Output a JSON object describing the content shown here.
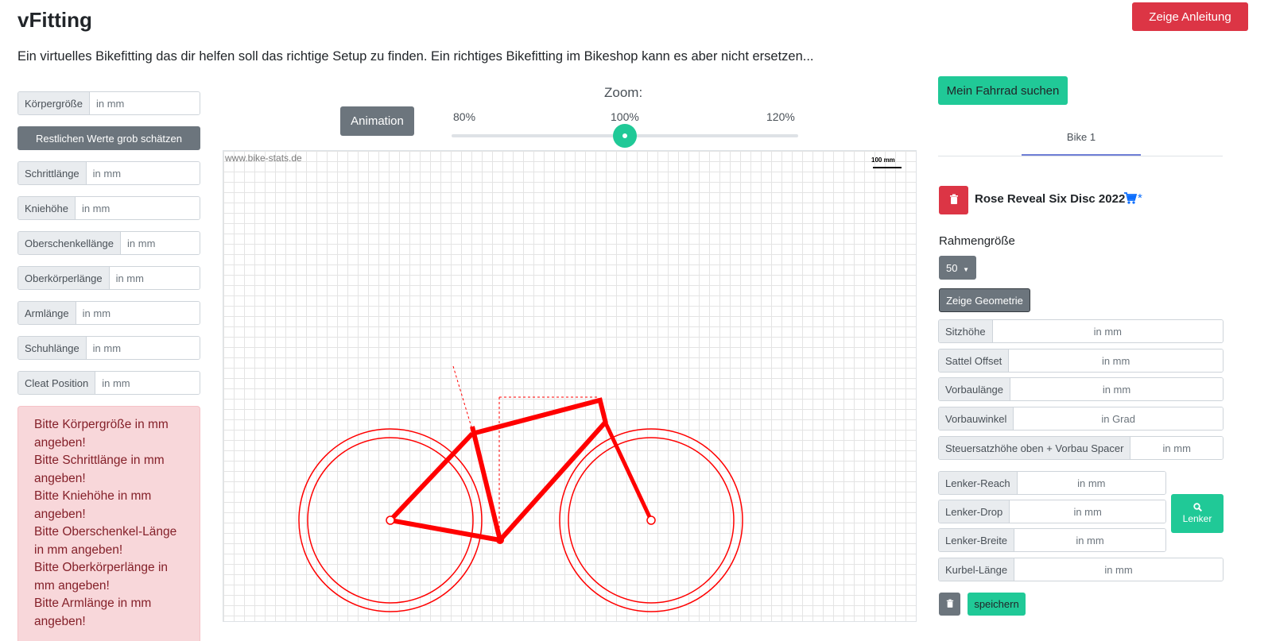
{
  "header": {
    "title": "vFitting",
    "guide_button": "Zeige Anleitung",
    "subtitle": "Ein virtuelles Bikefitting das dir helfen soll das richtige Setup zu finden. Ein richtiges Bikefitting im Bikeshop kann es aber nicht ersetzen..."
  },
  "body_inputs": {
    "height": {
      "label": "Körpergröße",
      "placeholder": "in mm"
    },
    "estimate_button": "Restlichen Werte grob schätzen",
    "fields": [
      {
        "label": "Schrittlänge",
        "placeholder": "in mm"
      },
      {
        "label": "Kniehöhe",
        "placeholder": "in mm"
      },
      {
        "label": "Oberschenkellänge",
        "placeholder": "in mm"
      },
      {
        "label": "Oberkörperlänge",
        "placeholder": "in mm"
      },
      {
        "label": "Armlänge",
        "placeholder": "in mm"
      },
      {
        "label": "Schuhlänge",
        "placeholder": "in mm"
      },
      {
        "label": "Cleat Position",
        "placeholder": "in mm"
      }
    ]
  },
  "alert": {
    "lines": [
      "Bitte Körpergröße in mm angeben!",
      "Bitte Schrittlänge in mm angeben!",
      "Bitte Kniehöhe in mm angeben!",
      "Bitte Oberschenkel-Länge in mm angeben!",
      "Bitte Oberkörperlänge in mm angeben!",
      "Bitte Armlänge in mm angeben!"
    ]
  },
  "viewer": {
    "animation_button": "Animation",
    "zoom_label": "Zoom:",
    "zoom_ticks": [
      "80%",
      "100%",
      "120%"
    ],
    "zoom_value": 100,
    "watermark": "www.bike-stats.de",
    "scale_label": "100 mm"
  },
  "bike_panel": {
    "find_button": "Mein Fahrrad suchen",
    "tab": "Bike 1",
    "bike_name": "Rose Reveal Six Disc 2022",
    "asterisk": "*",
    "frame_size_label": "Rahmengröße",
    "frame_size_value": "50",
    "geometry_button": "Zeige Geometrie",
    "fields": [
      {
        "label": "Sitzhöhe",
        "placeholder": "in mm"
      },
      {
        "label": "Sattel Offset",
        "placeholder": "in mm"
      },
      {
        "label": "Vorbaulänge",
        "placeholder": "in mm"
      },
      {
        "label": "Vorbauwinkel",
        "placeholder": "in Grad"
      },
      {
        "label": "Steuersatzhöhe oben + Vorbau Spacer",
        "placeholder": "in mm"
      }
    ],
    "bar_fields": [
      {
        "label": "Lenker-Reach",
        "placeholder": "in mm"
      },
      {
        "label": "Lenker-Drop",
        "placeholder": "in mm"
      },
      {
        "label": "Lenker-Breite",
        "placeholder": "in mm"
      }
    ],
    "crank": {
      "label": "Kurbel-Länge",
      "placeholder": "in mm"
    },
    "lenker_button": "Lenker",
    "save_button": "speichern"
  },
  "colors": {
    "primary_teal": "#20c997",
    "danger_red": "#dc3545",
    "secondary_gray": "#6c757d",
    "frame_red": "#ff0000"
  }
}
